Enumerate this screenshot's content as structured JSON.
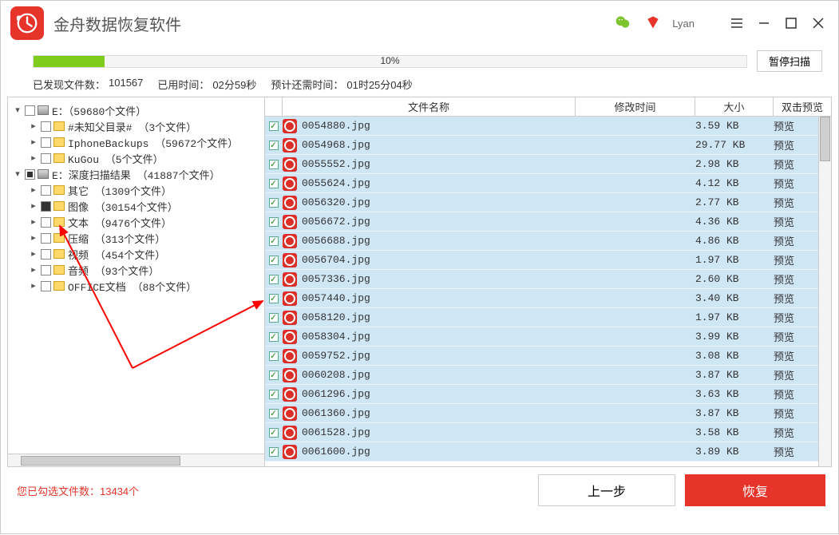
{
  "app": {
    "title": "金舟数据恢复软件",
    "username": "Lyan"
  },
  "progress": {
    "percent": "10%",
    "pause_label": "暂停扫描",
    "fill_width": "10%"
  },
  "status": {
    "found_label": "已发现文件数：",
    "found_count": "101567",
    "elapsed_label": "已用时间：",
    "elapsed_value": "02分59秒",
    "remain_label": "预计还需时间：",
    "remain_value": "01时25分04秒"
  },
  "tree": [
    {
      "level": 0,
      "toggle": "▾",
      "check": "empty",
      "icon": "drive",
      "label": "E：（59680个文件）"
    },
    {
      "level": 1,
      "toggle": "▸",
      "check": "empty",
      "icon": "folder",
      "label": "#未知父目录#  （3个文件）"
    },
    {
      "level": 1,
      "toggle": "▸",
      "check": "empty",
      "icon": "folder",
      "label": "IphoneBackups  （59672个文件）"
    },
    {
      "level": 1,
      "toggle": "▸",
      "check": "empty",
      "icon": "folder",
      "label": "KuGou  （5个文件）"
    },
    {
      "level": 0,
      "toggle": "▾",
      "check": "sel",
      "icon": "drive",
      "label": "E：深度扫描结果  （41887个文件）"
    },
    {
      "level": 1,
      "toggle": "▸",
      "check": "empty",
      "icon": "folder",
      "label": "其它  （1309个文件）"
    },
    {
      "level": 1,
      "toggle": "▸",
      "check": "filled",
      "icon": "folder",
      "label": "图像  （30154个文件）"
    },
    {
      "level": 1,
      "toggle": "▸",
      "check": "empty",
      "icon": "folder",
      "label": "文本  （9476个文件）"
    },
    {
      "level": 1,
      "toggle": "▸",
      "check": "empty",
      "icon": "folder",
      "label": "压缩  （313个文件）"
    },
    {
      "level": 1,
      "toggle": "▸",
      "check": "empty",
      "icon": "folder",
      "label": "视频  （454个文件）"
    },
    {
      "level": 1,
      "toggle": "▸",
      "check": "empty",
      "icon": "folder",
      "label": "音频  （93个文件）"
    },
    {
      "level": 1,
      "toggle": "▸",
      "check": "empty",
      "icon": "folder",
      "label": "OFFICE文档  （88个文件）"
    }
  ],
  "cols": {
    "name": "文件名称",
    "mtime": "修改时间",
    "size": "大小",
    "preview": "双击预览"
  },
  "files": [
    {
      "name": "0054880.jpg",
      "size": "3.59 KB",
      "preview": "预览"
    },
    {
      "name": "0054968.jpg",
      "size": "29.77 KB",
      "preview": "预览"
    },
    {
      "name": "0055552.jpg",
      "size": "2.98 KB",
      "preview": "预览"
    },
    {
      "name": "0055624.jpg",
      "size": "4.12 KB",
      "preview": "预览"
    },
    {
      "name": "0056320.jpg",
      "size": "2.77 KB",
      "preview": "预览"
    },
    {
      "name": "0056672.jpg",
      "size": "4.36 KB",
      "preview": "预览"
    },
    {
      "name": "0056688.jpg",
      "size": "4.86 KB",
      "preview": "预览"
    },
    {
      "name": "0056704.jpg",
      "size": "1.97 KB",
      "preview": "预览"
    },
    {
      "name": "0057336.jpg",
      "size": "2.60 KB",
      "preview": "预览"
    },
    {
      "name": "0057440.jpg",
      "size": "3.40 KB",
      "preview": "预览"
    },
    {
      "name": "0058120.jpg",
      "size": "1.97 KB",
      "preview": "预览"
    },
    {
      "name": "0058304.jpg",
      "size": "3.99 KB",
      "preview": "预览"
    },
    {
      "name": "0059752.jpg",
      "size": "3.08 KB",
      "preview": "预览"
    },
    {
      "name": "0060208.jpg",
      "size": "3.87 KB",
      "preview": "预览"
    },
    {
      "name": "0061296.jpg",
      "size": "3.63 KB",
      "preview": "预览"
    },
    {
      "name": "0061360.jpg",
      "size": "3.87 KB",
      "preview": "预览"
    },
    {
      "name": "0061528.jpg",
      "size": "3.58 KB",
      "preview": "预览"
    },
    {
      "name": "0061600.jpg",
      "size": "3.89 KB",
      "preview": "预览"
    }
  ],
  "footer": {
    "selected_label": "您已勾选文件数：",
    "selected_count": "13434个",
    "prev_label": "上一步",
    "recover_label": "恢复"
  }
}
